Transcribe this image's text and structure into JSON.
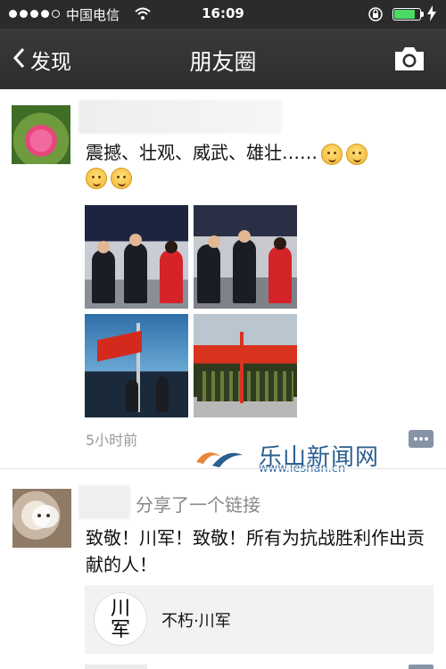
{
  "status_bar": {
    "carrier": "中国电信",
    "time": "16:09",
    "signal_bars_filled": 4,
    "signal_bars_total": 5,
    "battery_level": 0.85,
    "icons": [
      "wifi-icon",
      "orientation-lock-icon",
      "battery-icon",
      "charging-icon"
    ]
  },
  "nav": {
    "back_label": "发现",
    "title": "朋友圈",
    "right_icon": "camera-icon"
  },
  "posts": [
    {
      "text": "震撼、壮观、威武、雄壮……",
      "emoji_count": 4,
      "time": "5小时前",
      "photos": [
        "leaders-photo-1",
        "leaders-photo-2",
        "flag-raising-photo",
        "honor-guard-photo"
      ]
    },
    {
      "action": "分享了一个链接",
      "text": "致敬！川军！致敬！所有为抗战胜利作出贡献的人！",
      "link": {
        "logo_text": "川军",
        "title": "不朽·川军"
      }
    }
  ],
  "watermark": {
    "title": "乐山新闻网",
    "url": "www.leshan.cn"
  },
  "colors": {
    "nav_bg": "#2d2d2f",
    "battery": "#4cd964",
    "comment_button": "#8693a7",
    "watermark": "#2a5f8f"
  }
}
